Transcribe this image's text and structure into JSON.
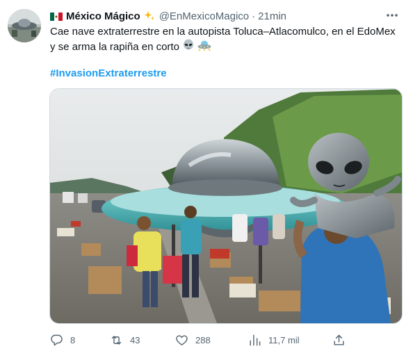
{
  "author": {
    "display_name": "México Mágico",
    "handle": "@EnMexicoMagico",
    "separator": "·",
    "time": "21min"
  },
  "tweet": {
    "text": "Cae nave extraterrestre en la autopista Toluca–Atlacomulco, en el EdoMex y se arma la rapiña en corto",
    "emojis": [
      "alien-emoji",
      "ufo-emoji"
    ],
    "hashtag": "#InvasionExtraterrestre"
  },
  "stats": {
    "replies": "8",
    "retweets": "43",
    "likes": "288",
    "views": "11,7 mil"
  },
  "colors": {
    "text": "#0f1419",
    "secondary": "#536471",
    "accent": "#1d9bf0",
    "border": "#cfd9de"
  },
  "icons": [
    "more-icon",
    "reply-icon",
    "retweet-icon",
    "like-icon",
    "views-icon",
    "share-icon"
  ]
}
